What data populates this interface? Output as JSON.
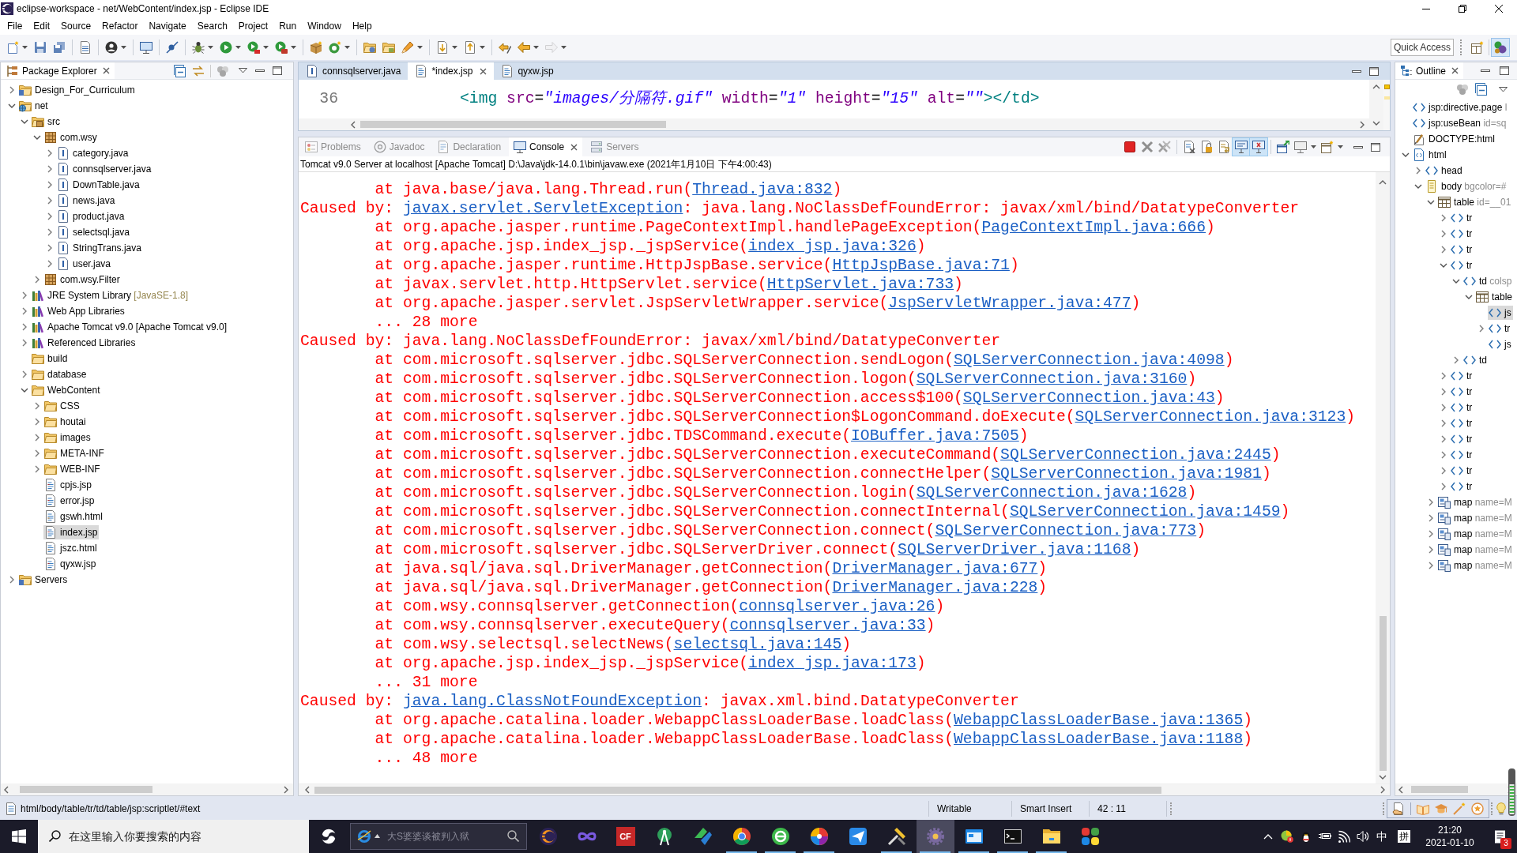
{
  "window": {
    "title": "eclipse-workspace - net/WebContent/index.jsp - Eclipse IDE"
  },
  "menu": [
    "File",
    "Edit",
    "Source",
    "Refactor",
    "Navigate",
    "Search",
    "Project",
    "Run",
    "Window",
    "Help"
  ],
  "toolbar": [
    [
      {
        "kind": "new",
        "dropdown": true,
        "disabled": false
      },
      {
        "kind": "save",
        "dropdown": false,
        "disabled": false
      },
      {
        "kind": "save-all",
        "dropdown": false,
        "disabled": false
      }
    ],
    [
      {
        "kind": "build",
        "dropdown": false,
        "disabled": false
      }
    ],
    [
      {
        "kind": "profile",
        "dropdown": true,
        "disabled": false
      }
    ],
    [
      {
        "kind": "terminal",
        "dropdown": false,
        "disabled": false
      }
    ],
    [
      {
        "kind": "skip-breakpoints",
        "dropdown": false,
        "disabled": false
      }
    ],
    [
      {
        "kind": "debug",
        "dropdown": true,
        "disabled": false
      },
      {
        "kind": "run",
        "dropdown": true,
        "disabled": false
      },
      {
        "kind": "coverage",
        "dropdown": true,
        "disabled": false
      },
      {
        "kind": "external-tools",
        "dropdown": true,
        "disabled": false
      }
    ],
    [
      {
        "kind": "new-project",
        "dropdown": false,
        "disabled": false
      },
      {
        "kind": "new-class",
        "dropdown": true,
        "disabled": false
      }
    ],
    [
      {
        "kind": "open-type",
        "dropdown": false,
        "disabled": false
      },
      {
        "kind": "open-task",
        "dropdown": false,
        "disabled": false
      },
      {
        "kind": "search",
        "dropdown": true,
        "disabled": false
      }
    ],
    [
      {
        "kind": "next-annotation",
        "dropdown": true,
        "disabled": false
      },
      {
        "kind": "previous-annotation",
        "dropdown": true,
        "disabled": false
      }
    ],
    [
      {
        "kind": "last-edit",
        "dropdown": false,
        "disabled": false
      },
      {
        "kind": "back",
        "dropdown": true,
        "disabled": false
      },
      {
        "kind": "forward",
        "dropdown": true,
        "disabled": true
      }
    ]
  ],
  "quick_access": {
    "placeholder": "Quick Access"
  },
  "perspectives": [
    {
      "kind": "open-perspective",
      "selected": false
    },
    {
      "kind": "java-ee",
      "selected": true
    }
  ],
  "package_explorer": {
    "title": "Package Explorer",
    "tree": [
      {
        "label": "Design_For_Curriculum",
        "kind": "project",
        "expanded": false,
        "selected": false
      },
      {
        "label": "net",
        "kind": "web-project",
        "expanded": true,
        "selected": false,
        "children": [
          {
            "label": "src",
            "kind": "source-folder",
            "expanded": true,
            "selected": false,
            "children": [
              {
                "label": "com.wsy",
                "kind": "package",
                "expanded": true,
                "selected": false,
                "children": [
                  {
                    "label": "category.java",
                    "kind": "java",
                    "expanded": false,
                    "selected": false
                  },
                  {
                    "label": "connsqlserver.java",
                    "kind": "java",
                    "expanded": false,
                    "selected": false
                  },
                  {
                    "label": "DownTable.java",
                    "kind": "java",
                    "expanded": false,
                    "selected": false
                  },
                  {
                    "label": "news.java",
                    "kind": "java",
                    "expanded": false,
                    "selected": false
                  },
                  {
                    "label": "product.java",
                    "kind": "java",
                    "expanded": false,
                    "selected": false
                  },
                  {
                    "label": "selectsql.java",
                    "kind": "java",
                    "expanded": false,
                    "selected": false
                  },
                  {
                    "label": "StringTrans.java",
                    "kind": "java",
                    "expanded": false,
                    "selected": false
                  },
                  {
                    "label": "user.java",
                    "kind": "java",
                    "expanded": false,
                    "selected": false
                  }
                ]
              },
              {
                "label": "com.wsy.Filter",
                "kind": "package",
                "expanded": false,
                "selected": false
              }
            ]
          },
          {
            "label": "JRE System Library",
            "decoration": "[JavaSE-1.8]",
            "kind": "library",
            "expanded": false,
            "selected": false
          },
          {
            "label": "Web App Libraries",
            "kind": "library",
            "expanded": false,
            "selected": false
          },
          {
            "label": "Apache Tomcat v9.0 [Apache Tomcat v9.0]",
            "kind": "library",
            "expanded": false,
            "selected": false
          },
          {
            "label": "Referenced Libraries",
            "kind": "library",
            "expanded": false,
            "selected": false
          },
          {
            "label": "build",
            "kind": "folder",
            "selected": false
          },
          {
            "label": "database",
            "kind": "folder",
            "expanded": false,
            "selected": false
          },
          {
            "label": "WebContent",
            "kind": "folder",
            "expanded": true,
            "selected": false,
            "children": [
              {
                "label": "CSS",
                "kind": "folder",
                "expanded": false,
                "selected": false
              },
              {
                "label": "houtai",
                "kind": "folder",
                "expanded": false,
                "selected": false
              },
              {
                "label": "images",
                "kind": "folder",
                "expanded": false,
                "selected": false
              },
              {
                "label": "META-INF",
                "kind": "folder",
                "expanded": false,
                "selected": false
              },
              {
                "label": "WEB-INF",
                "kind": "folder",
                "expanded": false,
                "selected": false
              },
              {
                "label": "cpjs.jsp",
                "kind": "jsp",
                "selected": false
              },
              {
                "label": "error.jsp",
                "kind": "jsp",
                "selected": false
              },
              {
                "label": "gswh.html",
                "kind": "html",
                "selected": false
              },
              {
                "label": "index.jsp",
                "kind": "jsp",
                "selected": true
              },
              {
                "label": "jszc.html",
                "kind": "html",
                "selected": false
              },
              {
                "label": "qyxw.jsp",
                "kind": "jsp",
                "selected": false
              }
            ]
          }
        ]
      },
      {
        "label": "Servers",
        "kind": "project",
        "expanded": false,
        "selected": false
      }
    ]
  },
  "editor": {
    "tabs": [
      {
        "label": "connsqlserver.java",
        "kind": "java",
        "selected": false
      },
      {
        "label": "*index.jsp",
        "kind": "jsp",
        "selected": true
      },
      {
        "label": "qyxw.jsp",
        "kind": "jsp",
        "selected": false
      }
    ],
    "lines": [
      {
        "number": "36",
        "segments": [
          {
            "kind": "tag",
            "text": "<img"
          },
          {
            "kind": "attr",
            "text": " src"
          },
          {
            "kind": "eq",
            "text": "="
          },
          {
            "kind": "string",
            "text": "\"images/分隔符.gif\""
          },
          {
            "kind": "attr",
            "text": " width"
          },
          {
            "kind": "eq",
            "text": "="
          },
          {
            "kind": "string",
            "text": "\"1\""
          },
          {
            "kind": "attr",
            "text": " height"
          },
          {
            "kind": "eq",
            "text": "="
          },
          {
            "kind": "string",
            "text": "\"15\""
          },
          {
            "kind": "attr",
            "text": " alt"
          },
          {
            "kind": "eq",
            "text": "="
          },
          {
            "kind": "string",
            "text": "\"\""
          },
          {
            "kind": "tag",
            "text": "></td>"
          }
        ]
      }
    ]
  },
  "console_view": {
    "tabs": [
      {
        "label": "Problems",
        "kind": "problems",
        "selected": false
      },
      {
        "label": "Javadoc",
        "kind": "javadoc",
        "selected": false
      },
      {
        "label": "Declaration",
        "kind": "declaration",
        "selected": false
      },
      {
        "label": "Console",
        "kind": "console",
        "selected": true
      },
      {
        "label": "Servers",
        "kind": "servers",
        "selected": false
      }
    ],
    "toolbar": [
      [
        {
          "kind": "terminate",
          "pressed": false,
          "dropdown": false
        },
        {
          "kind": "remove-launch",
          "pressed": false,
          "dropdown": false
        },
        {
          "kind": "remove-all",
          "pressed": false,
          "dropdown": false
        }
      ],
      [
        {
          "kind": "clear",
          "pressed": false,
          "dropdown": false
        },
        {
          "kind": "scroll-lock",
          "pressed": false,
          "dropdown": false
        },
        {
          "kind": "word-wrap",
          "pressed": false,
          "dropdown": false
        },
        {
          "kind": "show-stdout",
          "pressed": true,
          "dropdown": false
        },
        {
          "kind": "show-stderr",
          "pressed": true,
          "dropdown": false
        }
      ],
      [
        {
          "kind": "pin",
          "pressed": false,
          "dropdown": false
        },
        {
          "kind": "display",
          "pressed": false,
          "dropdown": true
        },
        {
          "kind": "open-console",
          "pressed": false,
          "dropdown": true
        }
      ]
    ],
    "description": "Tomcat v9.0 Server at localhost [Apache Tomcat] D:\\Java\\jdk-14.0.1\\bin\\javaw.exe (2021年1月10日 下午4:00:43)",
    "lines": [
      {
        "kind": "frame",
        "segments": [
          {
            "kind": "text",
            "text": "at java.base/java.lang.Thread.run("
          },
          {
            "kind": "link",
            "text": "Thread.java:832"
          },
          {
            "kind": "text",
            "text": ")"
          }
        ]
      },
      {
        "kind": "caused",
        "segments": [
          {
            "kind": "text",
            "text": "Caused by: "
          },
          {
            "kind": "link",
            "text": "javax.servlet.ServletException"
          },
          {
            "kind": "text",
            "text": ": java.lang.NoClassDefFoundError: javax/xml/bind/DatatypeConverter"
          }
        ]
      },
      {
        "kind": "frame",
        "segments": [
          {
            "kind": "text",
            "text": "at org.apache.jasper.runtime.PageContextImpl.handlePageException("
          },
          {
            "kind": "link",
            "text": "PageContextImpl.java:666"
          },
          {
            "kind": "text",
            "text": ")"
          }
        ]
      },
      {
        "kind": "frame",
        "segments": [
          {
            "kind": "text",
            "text": "at org.apache.jsp.index_jsp._jspService("
          },
          {
            "kind": "link",
            "text": "index_jsp.java:326"
          },
          {
            "kind": "text",
            "text": ")"
          }
        ]
      },
      {
        "kind": "frame",
        "segments": [
          {
            "kind": "text",
            "text": "at org.apache.jasper.runtime.HttpJspBase.service("
          },
          {
            "kind": "link",
            "text": "HttpJspBase.java:71"
          },
          {
            "kind": "text",
            "text": ")"
          }
        ]
      },
      {
        "kind": "frame",
        "segments": [
          {
            "kind": "text",
            "text": "at javax.servlet.http.HttpServlet.service("
          },
          {
            "kind": "link",
            "text": "HttpServlet.java:733"
          },
          {
            "kind": "text",
            "text": ")"
          }
        ]
      },
      {
        "kind": "frame",
        "segments": [
          {
            "kind": "text",
            "text": "at org.apache.jasper.servlet.JspServletWrapper.service("
          },
          {
            "kind": "link",
            "text": "JspServletWrapper.java:477"
          },
          {
            "kind": "text",
            "text": ")"
          }
        ]
      },
      {
        "kind": "frame",
        "segments": [
          {
            "kind": "text",
            "text": "... 28 more"
          }
        ]
      },
      {
        "kind": "caused",
        "segments": [
          {
            "kind": "text",
            "text": "Caused by: java.lang.NoClassDefFoundError: javax/xml/bind/DatatypeConverter"
          }
        ]
      },
      {
        "kind": "frame",
        "segments": [
          {
            "kind": "text",
            "text": "at com.microsoft.sqlserver.jdbc.SQLServerConnection.sendLogon("
          },
          {
            "kind": "link",
            "text": "SQLServerConnection.java:4098"
          },
          {
            "kind": "text",
            "text": ")"
          }
        ]
      },
      {
        "kind": "frame",
        "segments": [
          {
            "kind": "text",
            "text": "at com.microsoft.sqlserver.jdbc.SQLServerConnection.logon("
          },
          {
            "kind": "link",
            "text": "SQLServerConnection.java:3160"
          },
          {
            "kind": "text",
            "text": ")"
          }
        ]
      },
      {
        "kind": "frame",
        "segments": [
          {
            "kind": "text",
            "text": "at com.microsoft.sqlserver.jdbc.SQLServerConnection.access$100("
          },
          {
            "kind": "link",
            "text": "SQLServerConnection.java:43"
          },
          {
            "kind": "text",
            "text": ")"
          }
        ]
      },
      {
        "kind": "frame",
        "segments": [
          {
            "kind": "text",
            "text": "at com.microsoft.sqlserver.jdbc.SQLServerConnection$LogonCommand.doExecute("
          },
          {
            "kind": "link",
            "text": "SQLServerConnection.java:3123"
          },
          {
            "kind": "text",
            "text": ")"
          }
        ]
      },
      {
        "kind": "frame",
        "segments": [
          {
            "kind": "text",
            "text": "at com.microsoft.sqlserver.jdbc.TDSCommand.execute("
          },
          {
            "kind": "link",
            "text": "IOBuffer.java:7505"
          },
          {
            "kind": "text",
            "text": ")"
          }
        ]
      },
      {
        "kind": "frame",
        "segments": [
          {
            "kind": "text",
            "text": "at com.microsoft.sqlserver.jdbc.SQLServerConnection.executeCommand("
          },
          {
            "kind": "link",
            "text": "SQLServerConnection.java:2445"
          },
          {
            "kind": "text",
            "text": ")"
          }
        ]
      },
      {
        "kind": "frame",
        "segments": [
          {
            "kind": "text",
            "text": "at com.microsoft.sqlserver.jdbc.SQLServerConnection.connectHelper("
          },
          {
            "kind": "link",
            "text": "SQLServerConnection.java:1981"
          },
          {
            "kind": "text",
            "text": ")"
          }
        ]
      },
      {
        "kind": "frame",
        "segments": [
          {
            "kind": "text",
            "text": "at com.microsoft.sqlserver.jdbc.SQLServerConnection.login("
          },
          {
            "kind": "link",
            "text": "SQLServerConnection.java:1628"
          },
          {
            "kind": "text",
            "text": ")"
          }
        ]
      },
      {
        "kind": "frame",
        "segments": [
          {
            "kind": "text",
            "text": "at com.microsoft.sqlserver.jdbc.SQLServerConnection.connectInternal("
          },
          {
            "kind": "link",
            "text": "SQLServerConnection.java:1459"
          },
          {
            "kind": "text",
            "text": ")"
          }
        ]
      },
      {
        "kind": "frame",
        "segments": [
          {
            "kind": "text",
            "text": "at com.microsoft.sqlserver.jdbc.SQLServerConnection.connect("
          },
          {
            "kind": "link",
            "text": "SQLServerConnection.java:773"
          },
          {
            "kind": "text",
            "text": ")"
          }
        ]
      },
      {
        "kind": "frame",
        "segments": [
          {
            "kind": "text",
            "text": "at com.microsoft.sqlserver.jdbc.SQLServerDriver.connect("
          },
          {
            "kind": "link",
            "text": "SQLServerDriver.java:1168"
          },
          {
            "kind": "text",
            "text": ")"
          }
        ]
      },
      {
        "kind": "frame",
        "segments": [
          {
            "kind": "text",
            "text": "at java.sql/java.sql.DriverManager.getConnection("
          },
          {
            "kind": "link",
            "text": "DriverManager.java:677"
          },
          {
            "kind": "text",
            "text": ")"
          }
        ]
      },
      {
        "kind": "frame",
        "segments": [
          {
            "kind": "text",
            "text": "at java.sql/java.sql.DriverManager.getConnection("
          },
          {
            "kind": "link",
            "text": "DriverManager.java:228"
          },
          {
            "kind": "text",
            "text": ")"
          }
        ]
      },
      {
        "kind": "frame",
        "segments": [
          {
            "kind": "text",
            "text": "at com.wsy.connsqlserver.getConnection("
          },
          {
            "kind": "link",
            "text": "connsqlserver.java:26"
          },
          {
            "kind": "text",
            "text": ")"
          }
        ]
      },
      {
        "kind": "frame",
        "segments": [
          {
            "kind": "text",
            "text": "at com.wsy.connsqlserver.executeQuery("
          },
          {
            "kind": "link",
            "text": "connsqlserver.java:33"
          },
          {
            "kind": "text",
            "text": ")"
          }
        ]
      },
      {
        "kind": "frame",
        "segments": [
          {
            "kind": "text",
            "text": "at com.wsy.selectsql.selectNews("
          },
          {
            "kind": "link",
            "text": "selectsql.java:145"
          },
          {
            "kind": "text",
            "text": ")"
          }
        ]
      },
      {
        "kind": "frame",
        "segments": [
          {
            "kind": "text",
            "text": "at org.apache.jsp.index_jsp._jspService("
          },
          {
            "kind": "link",
            "text": "index_jsp.java:173"
          },
          {
            "kind": "text",
            "text": ")"
          }
        ]
      },
      {
        "kind": "frame",
        "segments": [
          {
            "kind": "text",
            "text": "... 31 more"
          }
        ]
      },
      {
        "kind": "caused",
        "segments": [
          {
            "kind": "text",
            "text": "Caused by: "
          },
          {
            "kind": "link",
            "text": "java.lang.ClassNotFoundException"
          },
          {
            "kind": "text",
            "text": ": javax.xml.bind.DatatypeConverter"
          }
        ]
      },
      {
        "kind": "frame",
        "segments": [
          {
            "kind": "text",
            "text": "at org.apache.catalina.loader.WebappClassLoaderBase.loadClass("
          },
          {
            "kind": "link",
            "text": "WebappClassLoaderBase.java:1365"
          },
          {
            "kind": "text",
            "text": ")"
          }
        ]
      },
      {
        "kind": "frame",
        "segments": [
          {
            "kind": "text",
            "text": "at org.apache.catalina.loader.WebappClassLoaderBase.loadClass("
          },
          {
            "kind": "link",
            "text": "WebappClassLoaderBase.java:1188"
          },
          {
            "kind": "text",
            "text": ")"
          }
        ]
      },
      {
        "kind": "frame",
        "segments": [
          {
            "kind": "text",
            "text": "... 48 more"
          }
        ]
      }
    ]
  },
  "outline": {
    "title": "Outline",
    "tree": [
      {
        "label": "jsp:directive.page",
        "detail": "l",
        "kind": "tag",
        "selected": false
      },
      {
        "label": "jsp:useBean",
        "detail": "id=sq",
        "kind": "tag",
        "selected": false
      },
      {
        "label": "DOCTYPE:html",
        "kind": "doctype",
        "selected": false
      },
      {
        "label": "html",
        "kind": "html",
        "expanded": true,
        "selected": false,
        "children": [
          {
            "label": "head",
            "kind": "tag",
            "expanded": false,
            "selected": false
          },
          {
            "label": "body",
            "detail": "bgcolor=#",
            "kind": "body",
            "expanded": true,
            "selected": false,
            "children": [
              {
                "label": "table",
                "detail": "id=__01",
                "kind": "table",
                "expanded": true,
                "selected": false,
                "children": [
                  {
                    "label": "tr",
                    "kind": "tag",
                    "expanded": false,
                    "selected": false
                  },
                  {
                    "label": "tr",
                    "kind": "tag",
                    "expanded": false,
                    "selected": false
                  },
                  {
                    "label": "tr",
                    "kind": "tag",
                    "expanded": false,
                    "selected": false
                  },
                  {
                    "label": "tr",
                    "kind": "tag",
                    "expanded": true,
                    "selected": false,
                    "children": [
                      {
                        "label": "td",
                        "detail": "colsp",
                        "kind": "tag",
                        "expanded": true,
                        "selected": false,
                        "children": [
                          {
                            "label": "table",
                            "kind": "table",
                            "expanded": true,
                            "selected": false,
                            "children": [
                              {
                                "label": "js",
                                "kind": "tag",
                                "selected": true
                              },
                              {
                                "label": "tr",
                                "kind": "tag",
                                "expanded": false,
                                "selected": false
                              },
                              {
                                "label": "js",
                                "kind": "tag",
                                "selected": false
                              }
                            ]
                          }
                        ]
                      },
                      {
                        "label": "td",
                        "kind": "tag",
                        "expanded": false,
                        "selected": false
                      }
                    ]
                  },
                  {
                    "label": "tr",
                    "kind": "tag",
                    "expanded": false,
                    "selected": false
                  },
                  {
                    "label": "tr",
                    "kind": "tag",
                    "expanded": false,
                    "selected": false
                  },
                  {
                    "label": "tr",
                    "kind": "tag",
                    "expanded": false,
                    "selected": false
                  },
                  {
                    "label": "tr",
                    "kind": "tag",
                    "expanded": false,
                    "selected": false
                  },
                  {
                    "label": "tr",
                    "kind": "tag",
                    "expanded": false,
                    "selected": false
                  },
                  {
                    "label": "tr",
                    "kind": "tag",
                    "expanded": false,
                    "selected": false
                  },
                  {
                    "label": "tr",
                    "kind": "tag",
                    "expanded": false,
                    "selected": false
                  },
                  {
                    "label": "tr",
                    "kind": "tag",
                    "expanded": false,
                    "selected": false
                  }
                ]
              },
              {
                "label": "map",
                "detail": "name=M",
                "kind": "map",
                "expanded": false,
                "selected": false
              },
              {
                "label": "map",
                "detail": "name=M",
                "kind": "map",
                "expanded": false,
                "selected": false
              },
              {
                "label": "map",
                "detail": "name=M",
                "kind": "map",
                "expanded": false,
                "selected": false
              },
              {
                "label": "map",
                "detail": "name=M",
                "kind": "map",
                "expanded": false,
                "selected": false
              },
              {
                "label": "map",
                "detail": "name=M",
                "kind": "map",
                "expanded": false,
                "selected": false
              }
            ]
          }
        ]
      }
    ]
  },
  "status_bar": {
    "path": "html/body/table/tr/td/table/jsp:scriptlet/#text",
    "fields": [
      "Writable",
      "Smart Insert",
      "42 : 11"
    ]
  },
  "taskbar": {
    "search": {
      "placeholder": "在这里输入你要搜索的内容"
    },
    "news_search": {
      "placeholder": "大S婆婆谈被判入狱"
    },
    "apps": [
      {
        "kind": "sphere",
        "active": false,
        "running": false
      },
      {
        "kind": "loops",
        "active": false,
        "running": false
      },
      {
        "kind": "tile",
        "label": "CF",
        "active": false,
        "running": false
      },
      {
        "kind": "compass",
        "active": false,
        "running": false
      },
      {
        "kind": "swoosh",
        "active": false,
        "running": false
      },
      {
        "kind": "ring",
        "active": false,
        "running": true
      },
      {
        "kind": "circle",
        "active": false,
        "running": true
      },
      {
        "kind": "pinwheel",
        "active": false,
        "running": true
      },
      {
        "kind": "plane",
        "active": false,
        "running": false
      },
      {
        "kind": "tools",
        "active": false,
        "running": true
      },
      {
        "kind": "gear",
        "active": true,
        "running": true
      },
      {
        "kind": "window",
        "active": false,
        "running": true
      },
      {
        "kind": "terminal",
        "active": false,
        "running": true
      },
      {
        "kind": "folder",
        "active": false,
        "running": true
      },
      {
        "kind": "squares",
        "active": false,
        "running": false
      }
    ],
    "input_method": "中",
    "input_mode": "拼",
    "time": "21:20",
    "date": "2021-01-10",
    "notification_count": "3"
  }
}
